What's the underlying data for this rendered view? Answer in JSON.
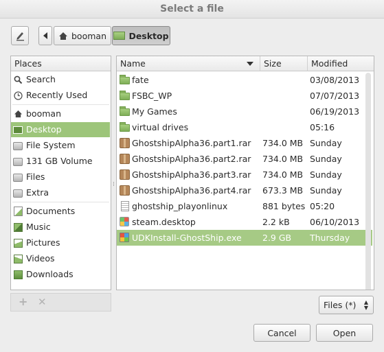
{
  "window": {
    "title": "Select a file"
  },
  "breadcrumb": {
    "home": "booman",
    "current": "Desktop"
  },
  "places": {
    "header": "Places",
    "items": [
      {
        "label": "Search",
        "icon": "search-icon"
      },
      {
        "label": "Recently Used",
        "icon": "clock-icon"
      },
      {
        "label": "booman",
        "icon": "home-icon"
      },
      {
        "label": "Desktop",
        "icon": "desktop-folder-icon"
      },
      {
        "label": "File System",
        "icon": "drive-icon"
      },
      {
        "label": "131 GB Volume",
        "icon": "drive-icon"
      },
      {
        "label": "Files",
        "icon": "drive-icon"
      },
      {
        "label": "Extra",
        "icon": "drive-icon"
      },
      {
        "label": "Documents",
        "icon": "documents-folder-icon"
      },
      {
        "label": "Music",
        "icon": "music-folder-icon"
      },
      {
        "label": "Pictures",
        "icon": "pictures-folder-icon"
      },
      {
        "label": "Videos",
        "icon": "videos-folder-icon"
      },
      {
        "label": "Downloads",
        "icon": "downloads-folder-icon"
      }
    ],
    "selected": "Desktop"
  },
  "files": {
    "columns": {
      "name": "Name",
      "size": "Size",
      "modified": "Modified"
    },
    "sort_icon": "sort-descending-icon",
    "rows": [
      {
        "name": "fate",
        "size": "",
        "modified": "03/08/2013",
        "type": "folder"
      },
      {
        "name": "FSBC_WP",
        "size": "",
        "modified": "07/07/2013",
        "type": "folder"
      },
      {
        "name": "My Games",
        "size": "",
        "modified": "06/19/2013",
        "type": "folder"
      },
      {
        "name": "virtual drives",
        "size": "",
        "modified": "05:16",
        "type": "folder"
      },
      {
        "name": "GhostshipAlpha36.part1.rar",
        "size": "734.0 MB",
        "modified": "Sunday",
        "type": "archive"
      },
      {
        "name": "GhostshipAlpha36.part2.rar",
        "size": "734.0 MB",
        "modified": "Sunday",
        "type": "archive"
      },
      {
        "name": "GhostshipAlpha36.part3.rar",
        "size": "734.0 MB",
        "modified": "Sunday",
        "type": "archive"
      },
      {
        "name": "GhostshipAlpha36.part4.rar",
        "size": "673.3 MB",
        "modified": "Sunday",
        "type": "archive"
      },
      {
        "name": "ghostship_playonlinux",
        "size": "881 bytes",
        "modified": "05:20",
        "type": "text"
      },
      {
        "name": "steam.desktop",
        "size": "2.2 kB",
        "modified": "06/10/2013",
        "type": "desktop"
      },
      {
        "name": "UDKInstall-GhostShip.exe",
        "size": "2.9 GB",
        "modified": "Thursday",
        "type": "exe"
      }
    ],
    "selected": "UDKInstall-GhostShip.exe"
  },
  "filter": {
    "label": "Files (*)"
  },
  "actions": {
    "cancel": "Cancel",
    "open": "Open"
  },
  "colors": {
    "selection": "#9dc57a",
    "folder": "#8fbc6a"
  }
}
